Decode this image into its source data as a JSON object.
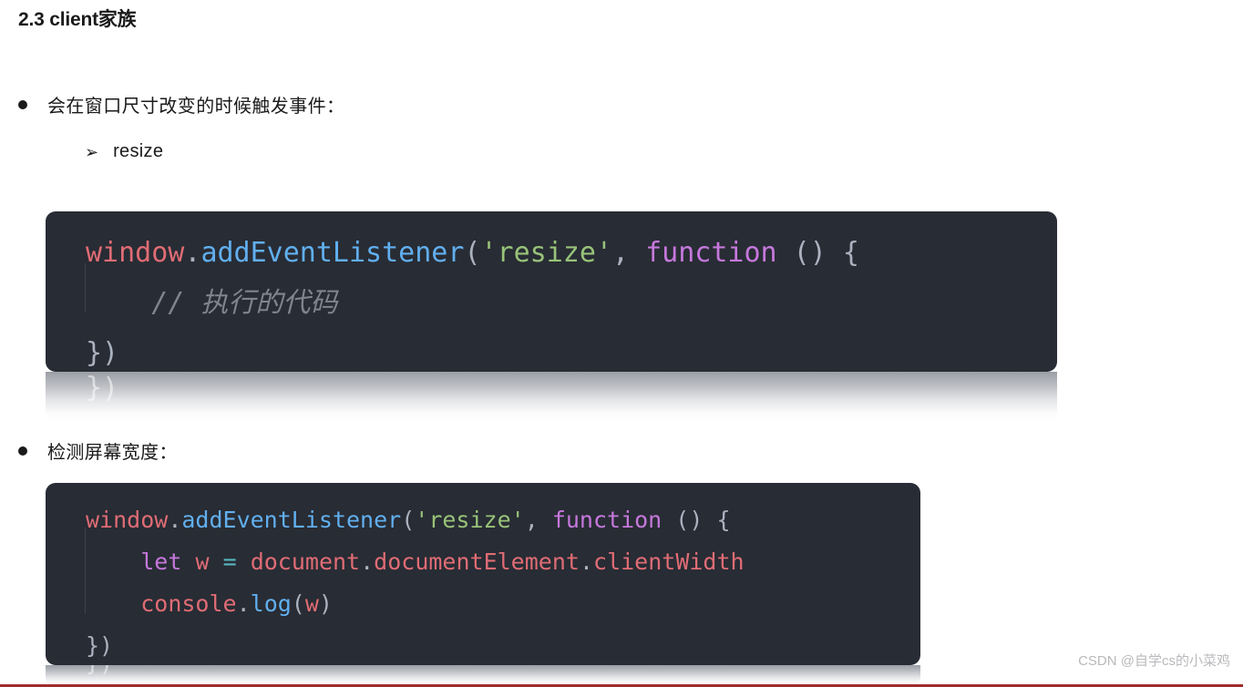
{
  "page": {
    "title": "2.3 client家族",
    "background_color": "#ffffff",
    "text_color": "#1a1a1a"
  },
  "sections": [
    {
      "bullet_marker": "●",
      "bullet_text": "会在窗口尺寸改变的时候触发事件：",
      "sub_items": [
        {
          "marker": "➢",
          "text": "resize"
        }
      ]
    },
    {
      "bullet_marker": "●",
      "bullet_text": "检测屏幕宽度："
    }
  ],
  "code_blocks": [
    {
      "id": "code-1",
      "language": "javascript",
      "background_color": "#282c34",
      "lines": [
        {
          "tokens": [
            {
              "text": "window",
              "type": "obj"
            },
            {
              "text": ".",
              "type": "dot"
            },
            {
              "text": "addEventListener",
              "type": "prop"
            },
            {
              "text": "(",
              "type": "punct"
            },
            {
              "text": "'resize'",
              "type": "str"
            },
            {
              "text": ",",
              "type": "punct"
            },
            {
              "text": " ",
              "type": "punct"
            },
            {
              "text": "function",
              "type": "kw"
            },
            {
              "text": " () {",
              "type": "punct"
            }
          ]
        },
        {
          "tokens": [
            {
              "text": "    // 执行的代码",
              "type": "cmt"
            }
          ]
        },
        {
          "tokens": [
            {
              "text": "})",
              "type": "punct"
            }
          ]
        }
      ],
      "reflection_text": "})"
    },
    {
      "id": "code-2",
      "language": "javascript",
      "background_color": "#282c34",
      "lines": [
        {
          "tokens": [
            {
              "text": "window",
              "type": "obj"
            },
            {
              "text": ".",
              "type": "dot"
            },
            {
              "text": "addEventListener",
              "type": "prop"
            },
            {
              "text": "(",
              "type": "punct"
            },
            {
              "text": "'resize'",
              "type": "str"
            },
            {
              "text": ",",
              "type": "punct"
            },
            {
              "text": " ",
              "type": "punct"
            },
            {
              "text": "function",
              "type": "kw"
            },
            {
              "text": " () {",
              "type": "punct"
            }
          ]
        },
        {
          "tokens": [
            {
              "text": "    ",
              "type": "punct"
            },
            {
              "text": "let",
              "type": "kw"
            },
            {
              "text": " ",
              "type": "punct"
            },
            {
              "text": "w",
              "type": "obj"
            },
            {
              "text": " ",
              "type": "punct"
            },
            {
              "text": "=",
              "type": "op"
            },
            {
              "text": " ",
              "type": "punct"
            },
            {
              "text": "document",
              "type": "obj"
            },
            {
              "text": ".",
              "type": "dot"
            },
            {
              "text": "documentElement",
              "type": "obj"
            },
            {
              "text": ".",
              "type": "dot"
            },
            {
              "text": "clientWidth",
              "type": "obj"
            }
          ]
        },
        {
          "tokens": [
            {
              "text": "    ",
              "type": "punct"
            },
            {
              "text": "console",
              "type": "obj"
            },
            {
              "text": ".",
              "type": "dot"
            },
            {
              "text": "log",
              "type": "prop"
            },
            {
              "text": "(",
              "type": "punct"
            },
            {
              "text": "w",
              "type": "obj"
            },
            {
              "text": ")",
              "type": "punct"
            }
          ]
        },
        {
          "tokens": [
            {
              "text": "})",
              "type": "punct"
            }
          ]
        }
      ],
      "reflection_text": "})"
    }
  ],
  "watermark": {
    "text": "CSDN @自学cs的小菜鸡",
    "color": "#b9b9bc"
  },
  "bottom_rule": {
    "color": "#a02c2c"
  },
  "syntax_colors": {
    "obj": "#e06c75",
    "prop": "#61afef",
    "str": "#98c379",
    "kw": "#c678dd",
    "op": "#56b6c2",
    "punct": "#abb2bf",
    "comment": "#7f848e"
  }
}
